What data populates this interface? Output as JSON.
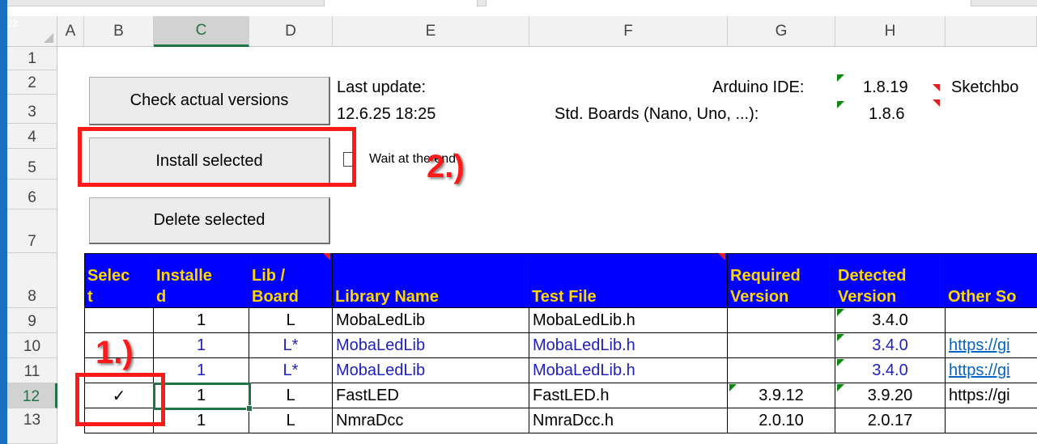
{
  "window": {
    "worksheet_number": "22"
  },
  "columns": [
    "A",
    "B",
    "C",
    "D",
    "E",
    "F",
    "G",
    "H"
  ],
  "rows": [
    "1",
    "2",
    "3",
    "4",
    "5",
    "6",
    "7",
    "8",
    "9",
    "10",
    "11",
    "12",
    "13"
  ],
  "buttons": {
    "check_versions": "Check actual versions",
    "install_selected": "Install selected",
    "delete_selected": "Delete selected"
  },
  "info": {
    "last_update_label": "Last update:",
    "last_update_value": "12.6.25 18:25",
    "arduino_ide_label": "Arduino IDE:",
    "arduino_ide_value": "1.8.19",
    "std_boards_label": "Std. Boards (Nano, Uno, ...):",
    "std_boards_value": "1.8.6",
    "sketchbook_label": "Sketchbo",
    "wait_at_end_label": "Wait at the end"
  },
  "annotations": {
    "step1": "1.)",
    "step2": "2.)"
  },
  "table": {
    "headers": [
      {
        "line1": "Selec",
        "line2": "t"
      },
      {
        "line1": "Installe",
        "line2": "d"
      },
      {
        "line1": "Lib /",
        "line2": "Board"
      },
      {
        "line1": "",
        "line2": "Library Name"
      },
      {
        "line1": "",
        "line2": "Test File"
      },
      {
        "line1": "Required",
        "line2": "Version"
      },
      {
        "line1": "Detected",
        "line2": "Version"
      },
      {
        "line1": "",
        "line2": "Other So"
      }
    ],
    "rows": [
      {
        "select": "",
        "installed": "1",
        "lib_board": "L",
        "library_name": "MobaLedLib",
        "test_file": "MobaLedLib.h",
        "required": "",
        "detected": "3.4.0",
        "other": ""
      },
      {
        "select": "",
        "installed": "1",
        "lib_board": "L*",
        "library_name": "MobaLedLib",
        "test_file": "MobaLedLib.h",
        "required": "",
        "detected": "3.4.0",
        "other": "https://gi"
      },
      {
        "select": "",
        "installed": "1",
        "lib_board": "L*",
        "library_name": "MobaLedLib",
        "test_file": "MobaLedLib.h",
        "required": "",
        "detected": "3.4.0",
        "other": "https://gi"
      },
      {
        "select": "✓",
        "installed": "1",
        "lib_board": "L",
        "library_name": "FastLED",
        "test_file": "FastLED.h",
        "required": "3.9.12",
        "detected": "3.9.20",
        "other": "https://gi"
      },
      {
        "select": "",
        "installed": "1",
        "lib_board": "L",
        "library_name": "NmraDcc",
        "test_file": "NmraDcc.h",
        "required": "2.0.10",
        "detected": "2.0.17",
        "other": ""
      }
    ]
  },
  "colors": {
    "header_bg": "#0000ff",
    "header_text": "#ffd700",
    "annotation_red": "#ff1a1a",
    "excel_green": "#217346"
  }
}
